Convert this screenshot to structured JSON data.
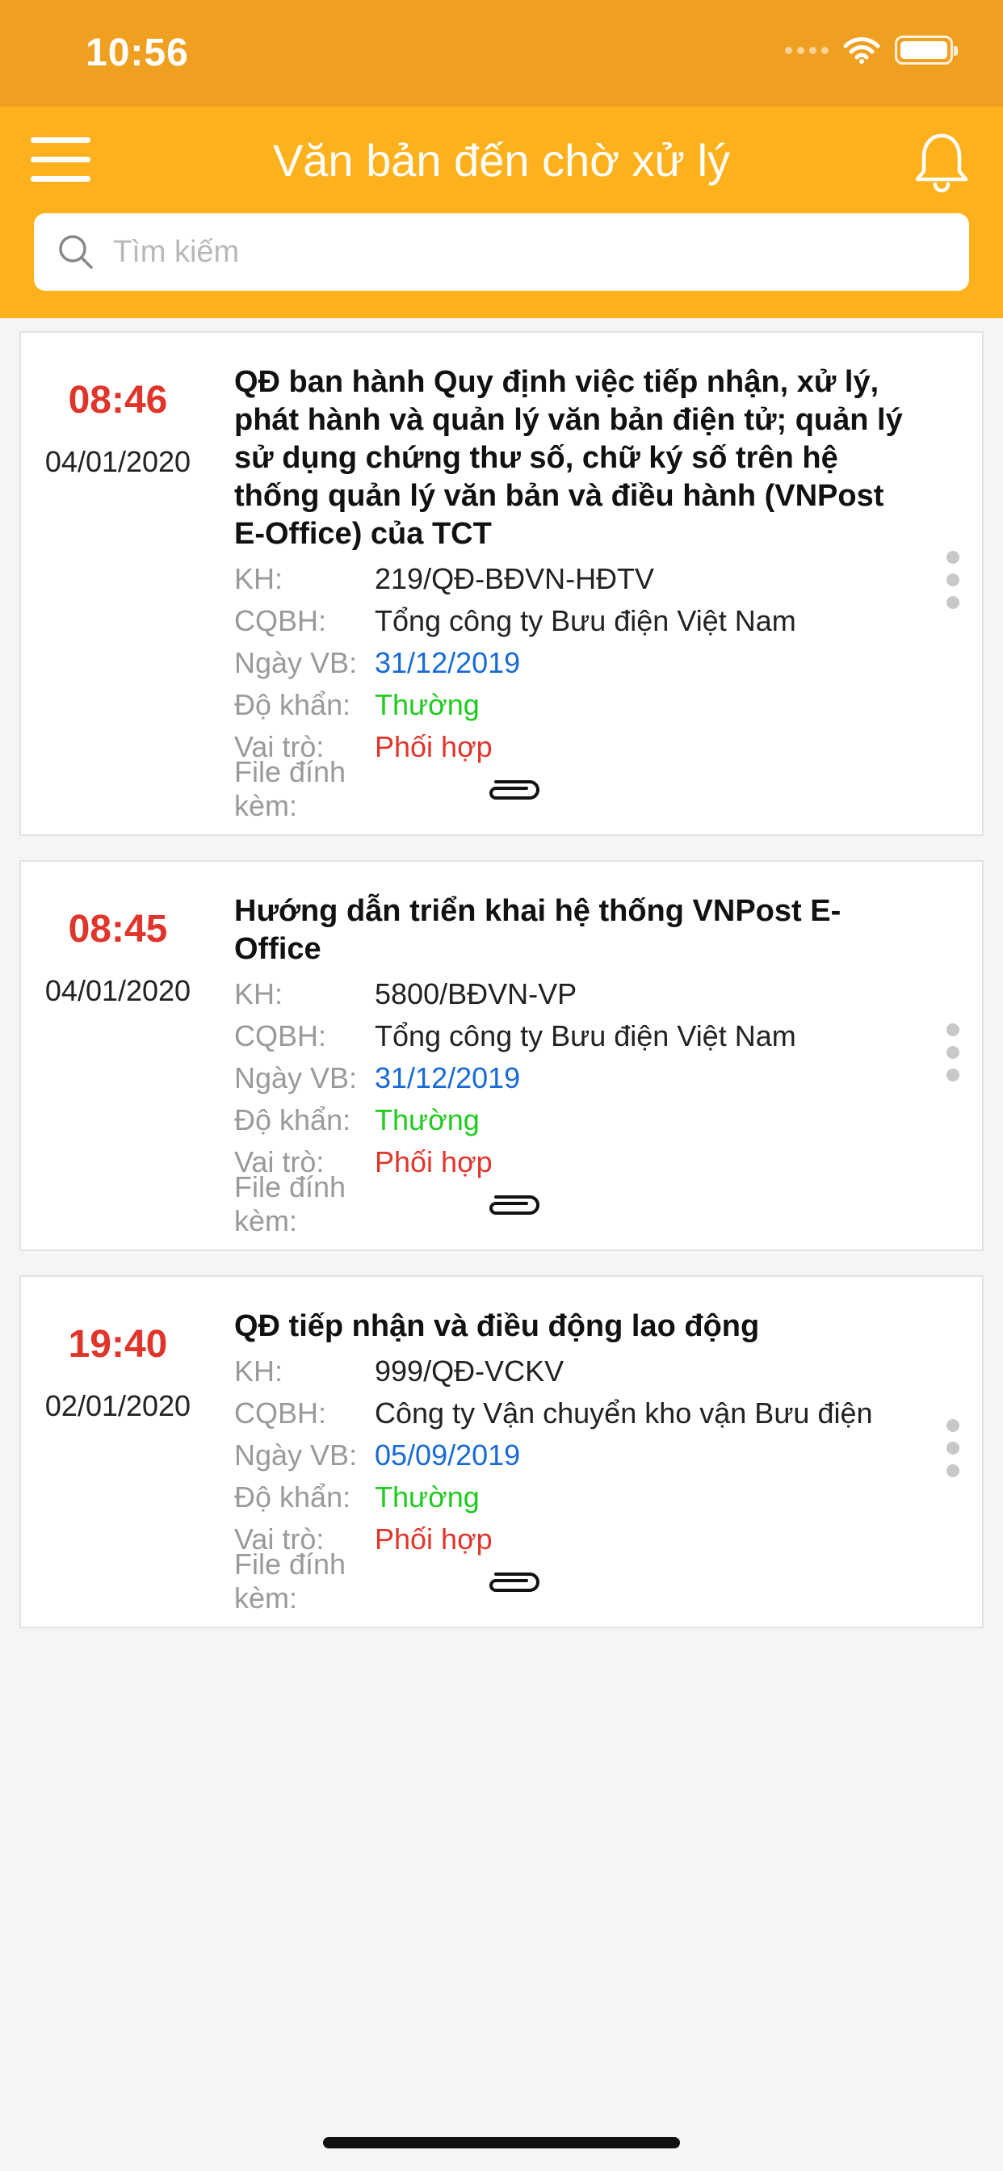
{
  "status_bar": {
    "time": "10:56"
  },
  "header": {
    "title": "Văn bản đến chờ xử lý"
  },
  "search": {
    "placeholder": "Tìm kiếm"
  },
  "field_labels": {
    "number": "KH:",
    "issuer": "CQBH:",
    "doc_date": "Ngày VB:",
    "urgency": "Độ khẩn:",
    "role": "Vai trò:",
    "attachment": "File đính kèm:"
  },
  "documents": [
    {
      "time": "08:46",
      "date": "04/01/2020",
      "title": "QĐ ban hành Quy định việc tiếp nhận, xử lý, phát hành và quản lý văn bản điện tử; quản lý sử dụng chứng thư số, chữ ký số trên hệ thống quản lý văn bản và điều hành (VNPost E-Office) của TCT",
      "number": "219/QĐ-BĐVN-HĐTV",
      "issuer": "Tổng công ty Bưu điện Việt Nam",
      "doc_date": "31/12/2019",
      "urgency": "Thường",
      "role": "Phối hợp",
      "attachment_icon": "paperclip-icon"
    },
    {
      "time": "08:45",
      "date": "04/01/2020",
      "title": "Hướng dẫn triển khai hệ thống VNPost E-Office",
      "number": "5800/BĐVN-VP",
      "issuer": "Tổng công ty Bưu điện Việt Nam",
      "doc_date": "31/12/2019",
      "urgency": "Thường",
      "role": "Phối hợp",
      "attachment_icon": "paperclip-icon"
    },
    {
      "time": "19:40",
      "date": "02/01/2020",
      "title": "QĐ tiếp nhận và điều động lao động",
      "number": "999/QĐ-VCKV",
      "issuer": "Công ty Vận chuyển kho vận Bưu điện",
      "doc_date": "05/09/2019",
      "urgency": "Thường",
      "role": "Phối hợp",
      "attachment_icon": "paperclip-icon"
    }
  ],
  "colors": {
    "status_bar_bg": "#f0a020",
    "header_bg": "#fdb21d",
    "time_red": "#e0352b",
    "date_blue": "#1a6ad6",
    "urgency_green": "#1ecb1e",
    "role_red": "#e0352b"
  }
}
